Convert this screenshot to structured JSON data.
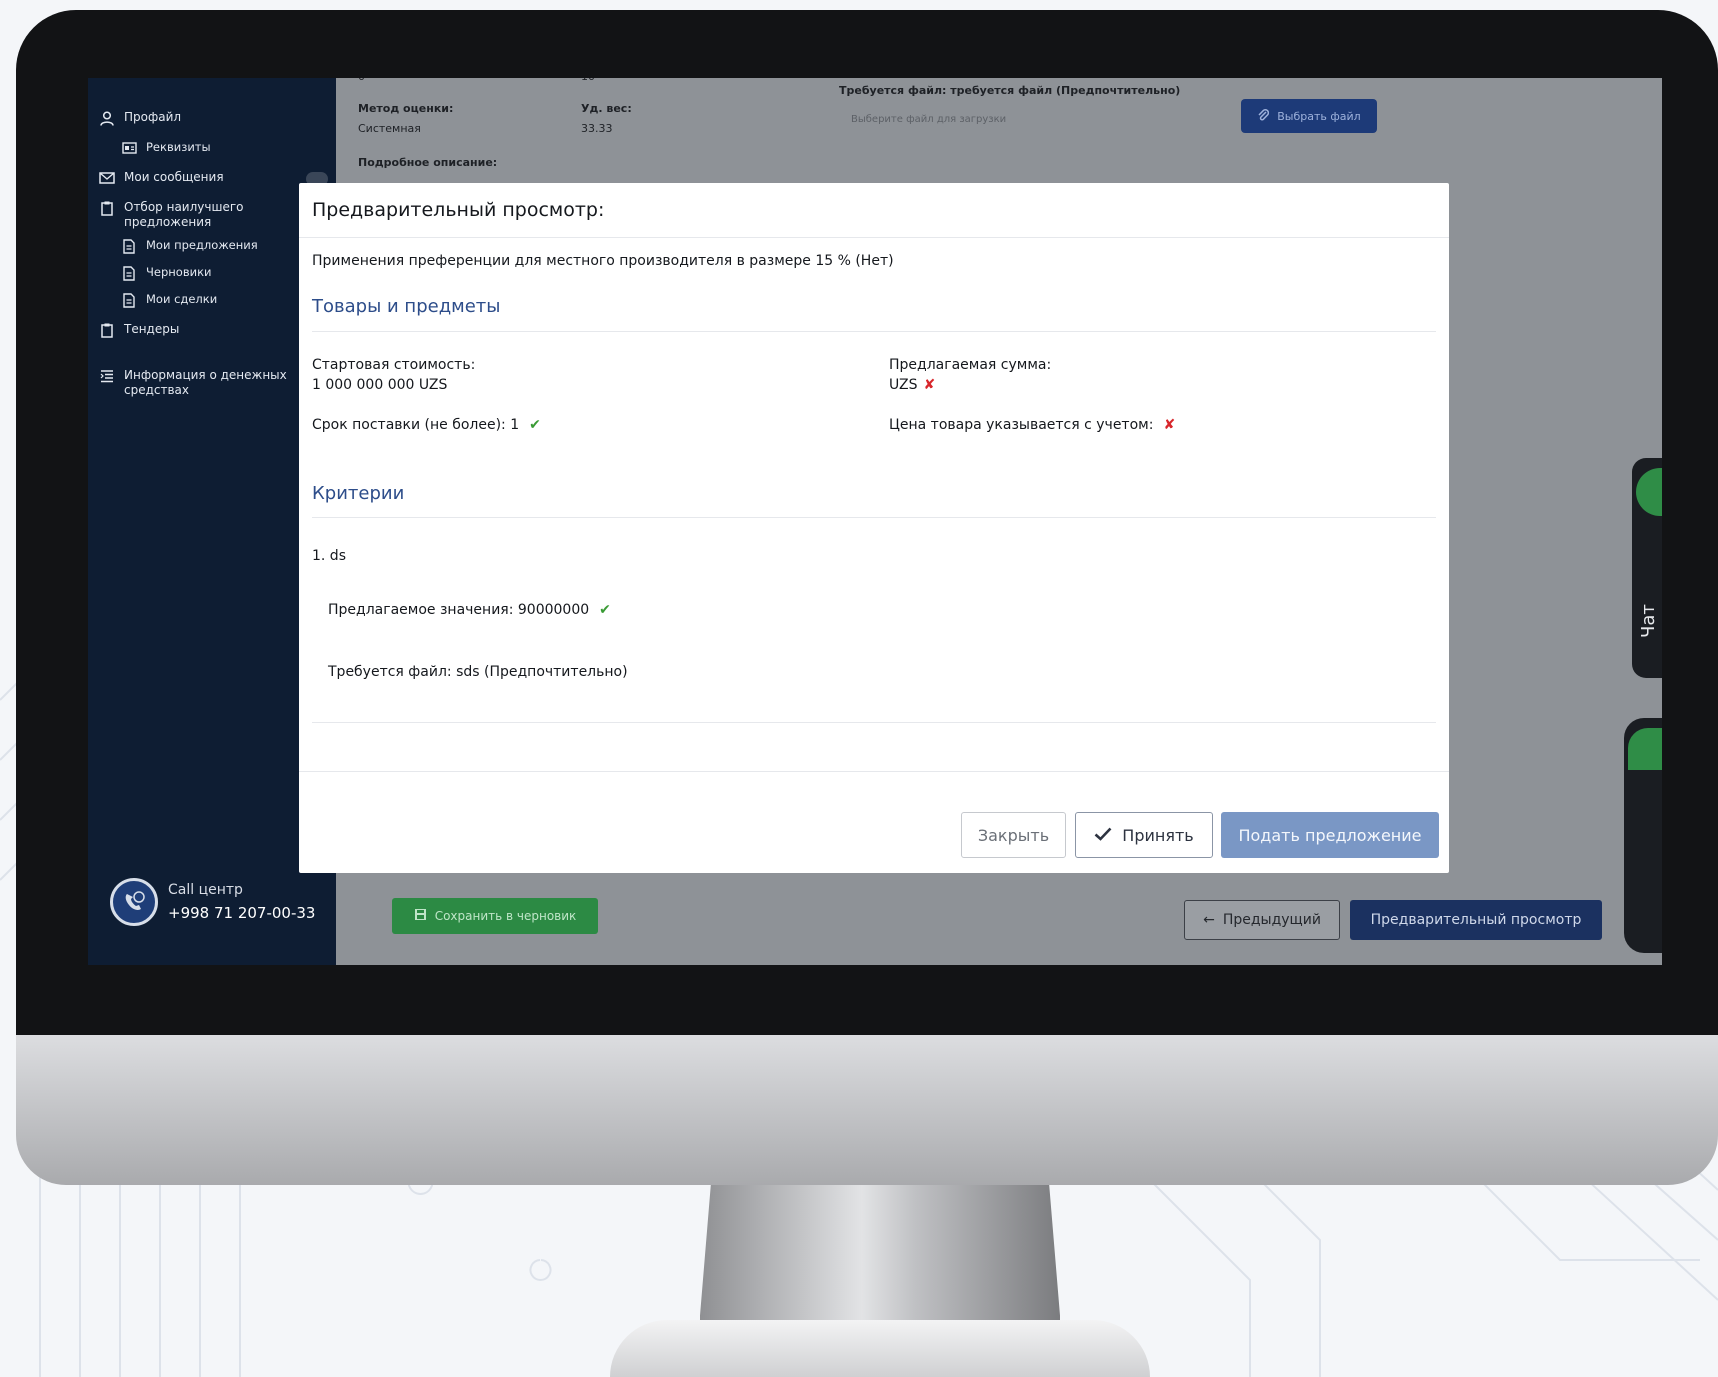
{
  "sidebar": {
    "items": [
      {
        "label": "Профайл",
        "icon": "user-icon"
      },
      {
        "label": "Реквизиты",
        "icon": "id-card-icon"
      },
      {
        "label": "Мои сообщения",
        "icon": "mail-icon"
      },
      {
        "label": "Отбор наилучшего предложения",
        "icon": "clipboard-icon"
      },
      {
        "label": "Мои предложения",
        "icon": "document-icon"
      },
      {
        "label": "Черновики",
        "icon": "document-icon"
      },
      {
        "label": "Мои сделки",
        "icon": "document-icon"
      },
      {
        "label": "Тендеры",
        "icon": "clipboard-icon"
      },
      {
        "label": "Информация о денежных средствах",
        "icon": "list-icon"
      }
    ],
    "call_center": {
      "title": "Call центр",
      "phone": "+998 71 207-00-33",
      "icon": "phone-24-icon"
    }
  },
  "background_form": {
    "col1_value_top": "0",
    "col2_value_top": "10",
    "method_label": "Метод оценки:",
    "method_value": "Системная",
    "weight_label": "Уд. вес:",
    "weight_value": "33.33",
    "description_label": "Подробное описание:",
    "required_file_text": "Требуется файл: требуется файл (Предпочтительно)",
    "file_placeholder": "Выберите файл для загрузки",
    "choose_file_label": "Выбрать файл",
    "save_draft_label": "Сохранить в черновик",
    "prev_label": "Предыдущий",
    "preview_label": "Предварительный просмотр",
    "chat_label": "Чат"
  },
  "modal": {
    "title": "Предварительный просмотр:",
    "preference_text": "Применения преференции для местного производителя в размере 15 % (Нет)",
    "goods_section_title": "Товары и предметы",
    "start_cost_label": "Стартовая стоимость:",
    "start_cost_value": "1 000 000 000 UZS",
    "proposed_sum_label": "Предлагаемая сумма:",
    "proposed_sum_value": "UZS",
    "delivery_label": "Срок поставки (не более): 1",
    "price_note_label": "Цена товара указывается с учетом:",
    "criteria_section_title": "Критерии",
    "criterion_name": "1. ds",
    "proposed_value_text": "Предлагаемое значения: 90000000",
    "required_file_text": "Требуется файл: sds (Предпочтительно)",
    "close_label": "Закрыть",
    "accept_label": "Принять",
    "submit_label": "Подать предложение",
    "mark_ok": "✔",
    "mark_x": "✘"
  },
  "colors": {
    "sidebar_bg": "#0e1d33",
    "section_title": "#2d4d8a",
    "ok_mark": "#3a9b35",
    "x_mark": "#d8262b",
    "submit_btn": "#7a97c5",
    "preview_btn": "#1b3160",
    "save_draft_btn": "#2c8a44"
  }
}
